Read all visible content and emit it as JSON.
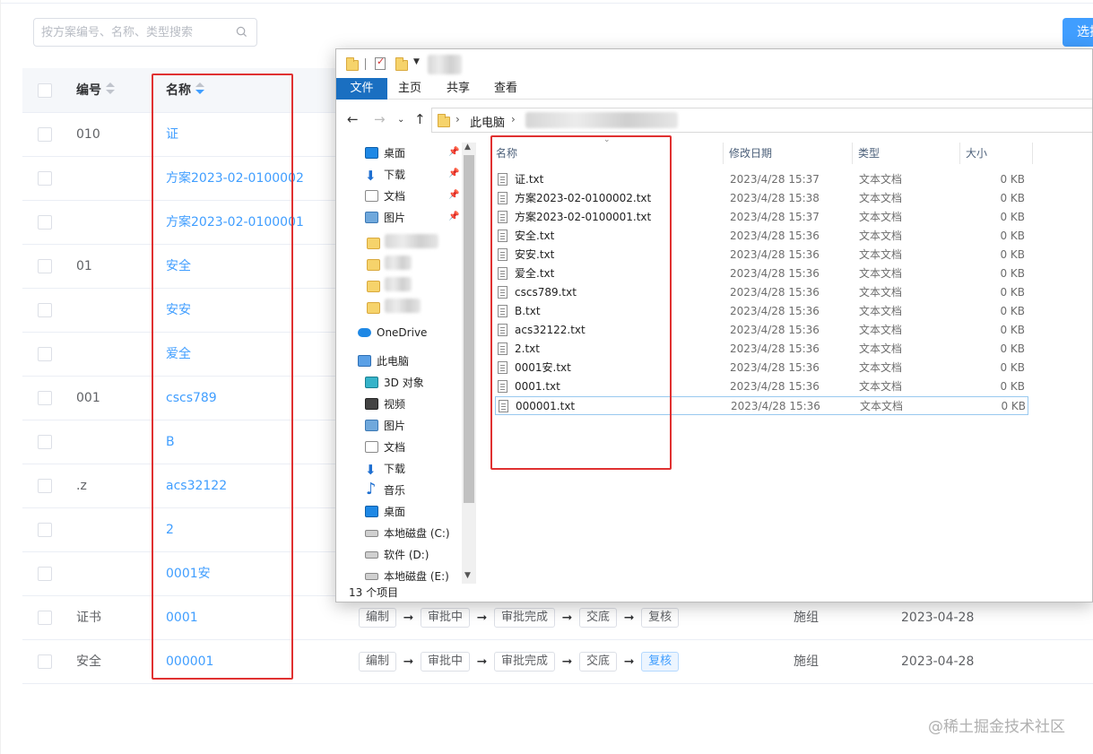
{
  "search": {
    "placeholder": "按方案编号、名称、类型搜索"
  },
  "select_button": "选择",
  "table": {
    "headers": {
      "code": "编号",
      "name": "名称"
    },
    "rows": [
      {
        "code": "010",
        "name": "证"
      },
      {
        "code": "",
        "name": "方案2023-02-0100002"
      },
      {
        "code": "",
        "name": "方案2023-02-0100001"
      },
      {
        "code": "01",
        "name": "安全"
      },
      {
        "code": "",
        "name": "安安"
      },
      {
        "code": "",
        "name": "爱全"
      },
      {
        "code": "001",
        "name": "cscs789"
      },
      {
        "code": "",
        "name": "B"
      },
      {
        "code": ".z",
        "name": "acs32122"
      },
      {
        "code": "",
        "name": "2"
      },
      {
        "code": "",
        "name": "0001安"
      },
      {
        "code": "证书",
        "name": "0001",
        "steps": [
          "编制",
          "审批中",
          "审批完成",
          "交底",
          "复核"
        ],
        "team": "施组",
        "date": "2023-04-28"
      },
      {
        "code": "安全",
        "name": "000001",
        "steps": [
          "编制",
          "审批中",
          "审批完成",
          "交底",
          "复核"
        ],
        "team": "施组",
        "date": "2023-04-28"
      }
    ]
  },
  "colors": {
    "accent": "#409eff",
    "highlight": "#e03131",
    "ribbon_file": "#1a6fc1"
  },
  "explorer": {
    "ribbon_tabs": [
      "文件",
      "主页",
      "共享",
      "查看"
    ],
    "breadcrumb": [
      "此电脑"
    ],
    "nav": {
      "quick_access": [
        {
          "label": "桌面",
          "icon": "desktop-icon"
        },
        {
          "label": "下载",
          "icon": "download-icon"
        },
        {
          "label": "文档",
          "icon": "document-icon"
        },
        {
          "label": "图片",
          "icon": "picture-icon"
        }
      ],
      "onedrive": "OneDrive",
      "this_pc": "此电脑",
      "pc_items": [
        {
          "label": "3D 对象",
          "icon": "3d-objects-icon"
        },
        {
          "label": "视频",
          "icon": "video-icon"
        },
        {
          "label": "图片",
          "icon": "picture-icon"
        },
        {
          "label": "文档",
          "icon": "document-icon"
        },
        {
          "label": "下载",
          "icon": "download-icon"
        },
        {
          "label": "音乐",
          "icon": "music-icon"
        },
        {
          "label": "桌面",
          "icon": "desktop-icon"
        },
        {
          "label": "本地磁盘 (C:)",
          "icon": "drive-icon"
        },
        {
          "label": "软件 (D:)",
          "icon": "drive-icon"
        },
        {
          "label": "本地磁盘 (E:)",
          "icon": "drive-icon"
        }
      ]
    },
    "columns": {
      "name": "名称",
      "modified": "修改日期",
      "type": "类型",
      "size": "大小"
    },
    "files": [
      {
        "name": "证.txt",
        "modified": "2023/4/28 15:37",
        "type": "文本文档",
        "size": "0 KB"
      },
      {
        "name": "方案2023-02-0100002.txt",
        "modified": "2023/4/28 15:38",
        "type": "文本文档",
        "size": "0 KB"
      },
      {
        "name": "方案2023-02-0100001.txt",
        "modified": "2023/4/28 15:37",
        "type": "文本文档",
        "size": "0 KB"
      },
      {
        "name": "安全.txt",
        "modified": "2023/4/28 15:36",
        "type": "文本文档",
        "size": "0 KB"
      },
      {
        "name": "安安.txt",
        "modified": "2023/4/28 15:36",
        "type": "文本文档",
        "size": "0 KB"
      },
      {
        "name": "爱全.txt",
        "modified": "2023/4/28 15:36",
        "type": "文本文档",
        "size": "0 KB"
      },
      {
        "name": "cscs789.txt",
        "modified": "2023/4/28 15:36",
        "type": "文本文档",
        "size": "0 KB"
      },
      {
        "name": "B.txt",
        "modified": "2023/4/28 15:36",
        "type": "文本文档",
        "size": "0 KB"
      },
      {
        "name": "acs32122.txt",
        "modified": "2023/4/28 15:36",
        "type": "文本文档",
        "size": "0 KB"
      },
      {
        "name": "2.txt",
        "modified": "2023/4/28 15:36",
        "type": "文本文档",
        "size": "0 KB"
      },
      {
        "name": "0001安.txt",
        "modified": "2023/4/28 15:36",
        "type": "文本文档",
        "size": "0 KB"
      },
      {
        "name": "0001.txt",
        "modified": "2023/4/28 15:36",
        "type": "文本文档",
        "size": "0 KB"
      },
      {
        "name": "000001.txt",
        "modified": "2023/4/28 15:36",
        "type": "文本文档",
        "size": "0 KB"
      }
    ],
    "status": "13 个项目"
  },
  "watermark": "@稀土掘金技术社区"
}
